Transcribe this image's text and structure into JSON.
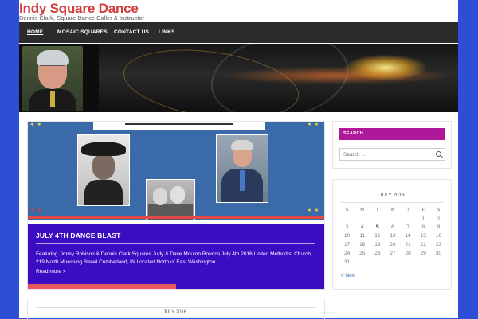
{
  "site": {
    "title": "Indy Square Dance",
    "description": "Dennis Clark, Square Dance Caller & Instructor"
  },
  "nav": {
    "items": [
      "HOME",
      "MOSAIC SQUARES",
      "CONTACT US",
      "LINKS"
    ],
    "active": "HOME"
  },
  "post": {
    "title": "JULY 4TH DANCE BLAST",
    "excerpt": "Featuring Jimmy Robison & Dennis Clark Squares Judy & Dave Mouton Rounds July 4th 2016   United Methodist Church, 219 North Muessing Street Cumberland, IN Located North of East Washington",
    "read_more": "Read more »",
    "slider_progress": 0.5
  },
  "second_widget": {
    "caption": "JULY 2016"
  },
  "sidebar": {
    "search": {
      "heading": "SEARCH",
      "placeholder": "Search ..."
    },
    "calendar": {
      "caption": "JULY 2016",
      "weekdays": [
        "S",
        "M",
        "T",
        "W",
        "T",
        "F",
        "S"
      ],
      "weeks": [
        [
          "",
          "",
          "",
          "",
          "",
          "1",
          "2"
        ],
        [
          "3",
          "4",
          "5",
          "6",
          "7",
          "8",
          "9"
        ],
        [
          "10",
          "11",
          "12",
          "13",
          "14",
          "15",
          "16"
        ],
        [
          "17",
          "18",
          "19",
          "20",
          "21",
          "22",
          "23"
        ],
        [
          "24",
          "25",
          "26",
          "27",
          "28",
          "29",
          "30"
        ],
        [
          "31",
          "",
          "",
          "",
          "",
          "",
          ""
        ]
      ],
      "highlight": "5",
      "prev": "« Nov"
    }
  },
  "colors": {
    "background": "#2d4fd6",
    "accent_title": "#d23c3c",
    "post_panel": "#3b0dc2",
    "widget_head": "#b0189a",
    "nav": "#2b2b2b"
  }
}
